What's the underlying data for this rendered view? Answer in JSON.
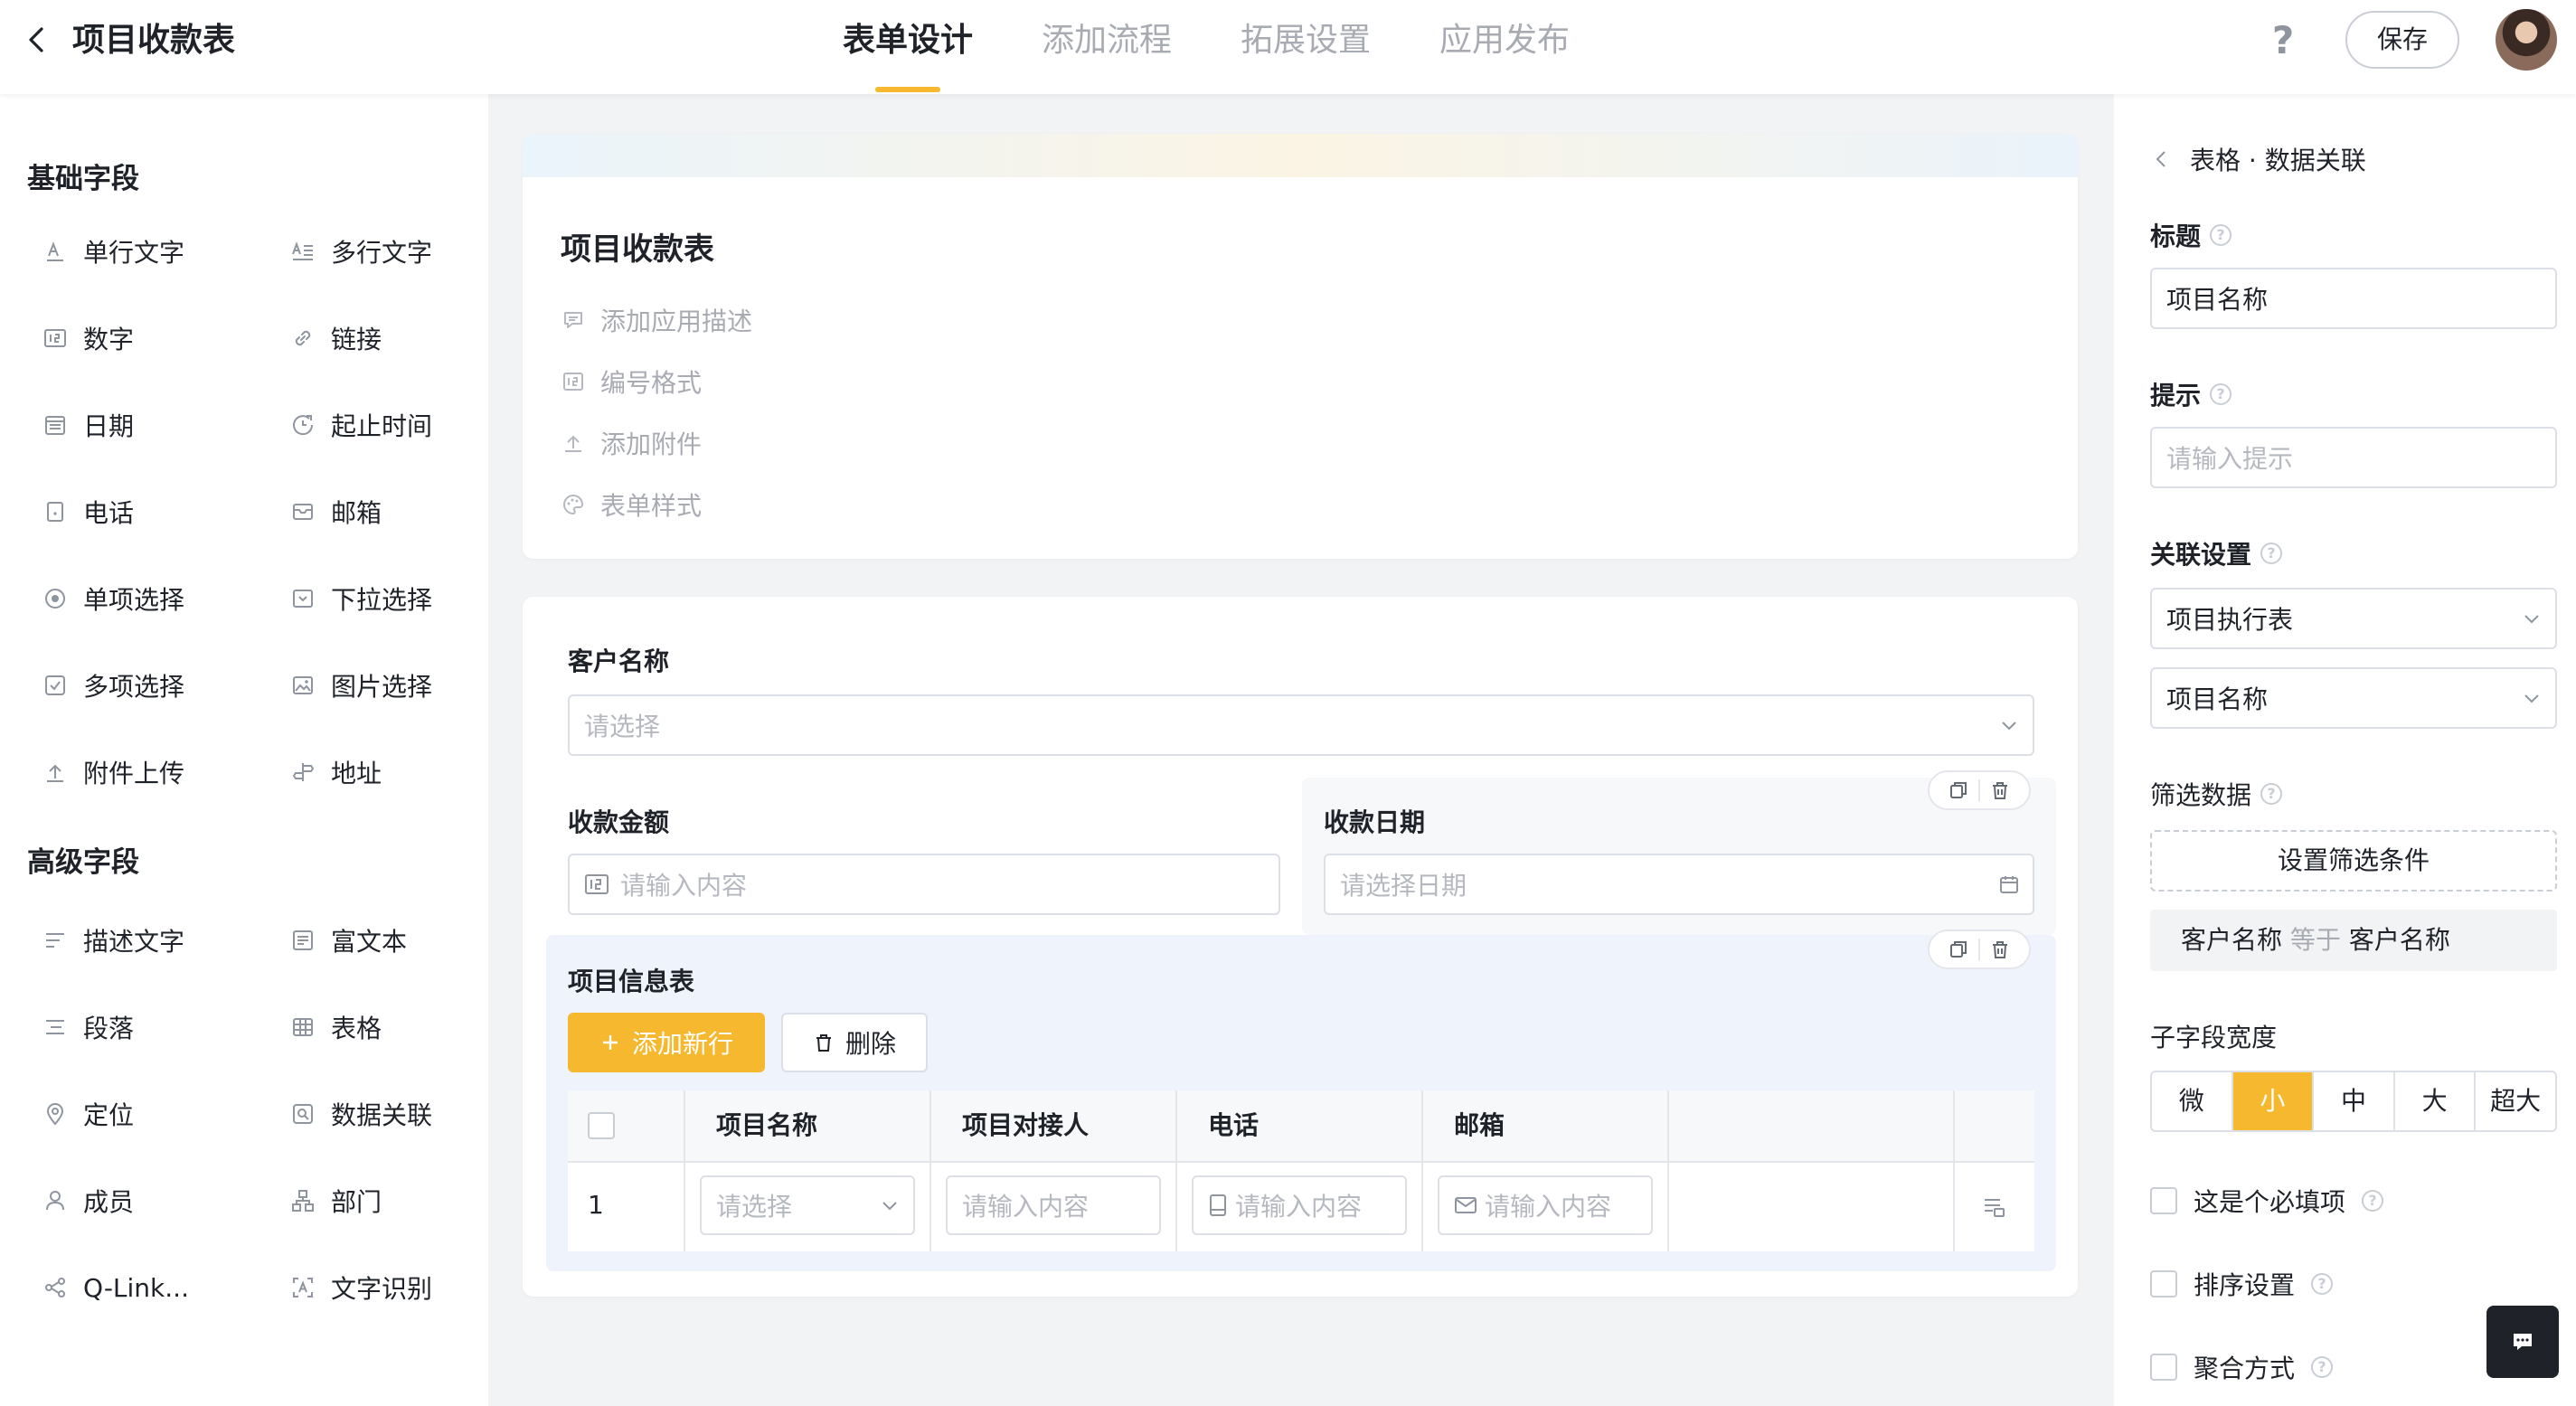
{
  "header": {
    "title": "项目收款表",
    "tabs": [
      {
        "label": "表单设计",
        "active": true
      },
      {
        "label": "添加流程",
        "active": false
      },
      {
        "label": "拓展设置",
        "active": false
      },
      {
        "label": "应用发布",
        "active": false
      }
    ],
    "help": "?",
    "save": "保存"
  },
  "sidebar": {
    "basic_title": "基础字段",
    "basic": [
      {
        "label": "单行文字",
        "icon": "single-line-text-icon"
      },
      {
        "label": "多行文字",
        "icon": "multi-line-text-icon"
      },
      {
        "label": "数字",
        "icon": "number-icon"
      },
      {
        "label": "链接",
        "icon": "link-icon"
      },
      {
        "label": "日期",
        "icon": "date-icon"
      },
      {
        "label": "起止时间",
        "icon": "time-range-icon"
      },
      {
        "label": "电话",
        "icon": "phone-icon"
      },
      {
        "label": "邮箱",
        "icon": "mail-icon"
      },
      {
        "label": "单项选择",
        "icon": "radio-icon"
      },
      {
        "label": "下拉选择",
        "icon": "dropdown-icon"
      },
      {
        "label": "多项选择",
        "icon": "checkbox-icon"
      },
      {
        "label": "图片选择",
        "icon": "image-icon"
      },
      {
        "label": "附件上传",
        "icon": "upload-icon"
      },
      {
        "label": "地址",
        "icon": "address-icon"
      }
    ],
    "advanced_title": "高级字段",
    "advanced": [
      {
        "label": "描述文字",
        "icon": "description-icon"
      },
      {
        "label": "富文本",
        "icon": "rich-text-icon"
      },
      {
        "label": "段落",
        "icon": "paragraph-icon"
      },
      {
        "label": "表格",
        "icon": "table-icon"
      },
      {
        "label": "定位",
        "icon": "location-icon"
      },
      {
        "label": "数据关联",
        "icon": "data-link-icon"
      },
      {
        "label": "成员",
        "icon": "member-icon"
      },
      {
        "label": "部门",
        "icon": "department-icon"
      },
      {
        "label": "Q-Link...",
        "icon": "share-icon"
      },
      {
        "label": "文字识别",
        "icon": "ocr-icon"
      }
    ]
  },
  "form": {
    "title": "项目收款表",
    "links": [
      {
        "label": "添加应用描述",
        "icon": "comment-icon"
      },
      {
        "label": "编号格式",
        "icon": "number-format-icon"
      },
      {
        "label": "添加附件",
        "icon": "upload-icon"
      },
      {
        "label": "表单样式",
        "icon": "palette-icon"
      }
    ],
    "customer": {
      "label": "客户名称",
      "placeholder": "请选择"
    },
    "amount": {
      "label": "收款金额",
      "placeholder": "请输入内容"
    },
    "date": {
      "label": "收款日期",
      "placeholder": "请选择日期"
    },
    "table": {
      "label": "项目信息表",
      "add_row": "添加新行",
      "delete": "删除",
      "columns": [
        "项目名称",
        "项目对接人",
        "电话",
        "邮箱"
      ],
      "row_index": "1",
      "cells": [
        "请选择",
        "请输入内容",
        "请输入内容",
        "请输入内容"
      ]
    }
  },
  "panel": {
    "breadcrumb": "表格 · 数据关联",
    "title_label": "标题",
    "title_value": "项目名称",
    "hint_label": "提示",
    "hint_placeholder": "请输入提示",
    "relation_label": "关联设置",
    "relation_table": "项目执行表",
    "relation_field": "项目名称",
    "filter_label": "筛选数据",
    "filter_button": "设置筛选条件",
    "filter_rule": {
      "field": "客户名称",
      "op": "等于",
      "value": "客户名称"
    },
    "width_label": "子字段宽度",
    "width_options": [
      "微",
      "小",
      "中",
      "大",
      "超大"
    ],
    "width_selected": "小",
    "checks": [
      {
        "label": "这是个必填项",
        "checked": false
      },
      {
        "label": "排序设置",
        "checked": false
      },
      {
        "label": "聚合方式",
        "checked": false
      }
    ]
  },
  "colors": {
    "accent": "#f5b82e",
    "page_bg": "#f2f3f5",
    "table_bg": "#eff3fb"
  }
}
